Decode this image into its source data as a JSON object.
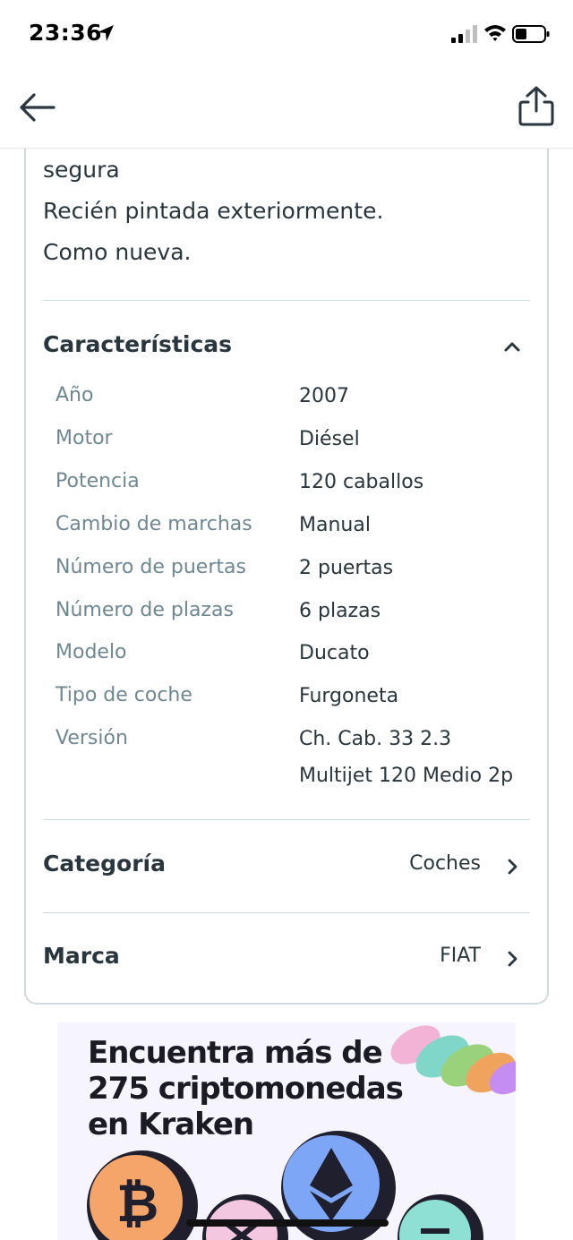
{
  "status_bar": {
    "time": "23:36"
  },
  "description": {
    "lines": [
      "segura",
      "Recién pintada exteriormente.",
      "Como nueva."
    ]
  },
  "characteristics": {
    "title": "Características",
    "items": [
      {
        "label": "Año",
        "value": "2007"
      },
      {
        "label": "Motor",
        "value": "Diésel"
      },
      {
        "label": "Potencia",
        "value": "120 caballos"
      },
      {
        "label": "Cambio de marchas",
        "value": "Manual"
      },
      {
        "label": "Número de puertas",
        "value": "2 puertas"
      },
      {
        "label": "Número de plazas",
        "value": "6 plazas"
      },
      {
        "label": "Modelo",
        "value": "Ducato"
      },
      {
        "label": "Tipo de coche",
        "value": "Furgoneta"
      },
      {
        "label": "Versión",
        "value": "Ch. Cab. 33 2.3",
        "value_line2": "Multijet 120 Medio 2p"
      }
    ]
  },
  "category": {
    "title": "Categoría",
    "value": "Coches"
  },
  "brand": {
    "title": "Marca",
    "value": "FIAT"
  },
  "ad": {
    "lines": [
      "Encuentra más de",
      "275 criptomonedas",
      "en Kraken"
    ]
  },
  "icons": {
    "back": "arrow-left-icon",
    "share": "share-icon",
    "collapse": "chevron-up-icon",
    "navigate": "chevron-right-icon"
  }
}
